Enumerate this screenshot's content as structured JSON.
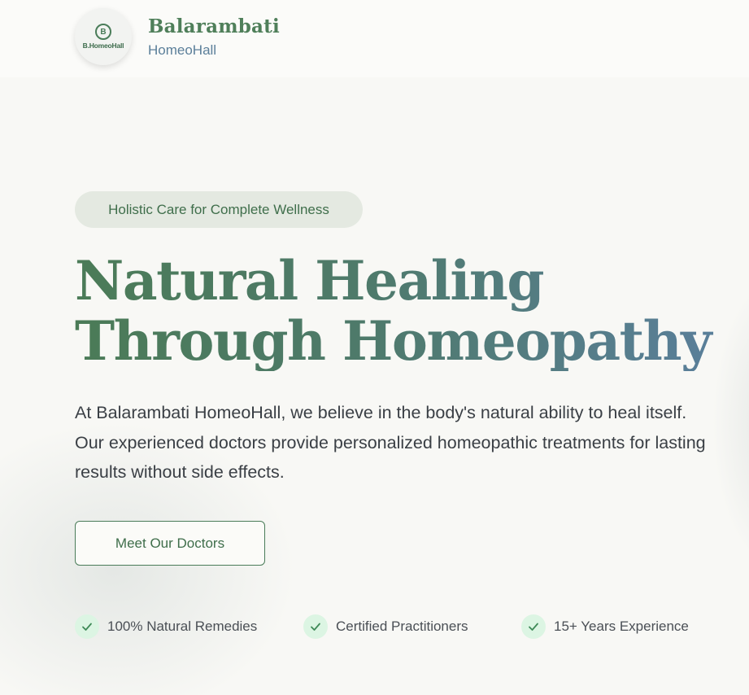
{
  "header": {
    "logo_mark": "B",
    "logo_text": "B.HomeoHall",
    "brand_name": "Balarambati",
    "brand_sub": "HomeoHall"
  },
  "hero": {
    "tagline": "Holistic Care for Complete Wellness",
    "headline_line1": "Natural Healing",
    "headline_line2": "Through Homeopathy",
    "description": "At Balarambati HomeoHall, we believe in the body's natural ability to heal itself. Our experienced doctors provide personalized homeopathic treatments for lasting results without side effects.",
    "cta_label": "Meet Our Doctors"
  },
  "features": [
    {
      "label": "100% Natural Remedies",
      "icon": "check-icon"
    },
    {
      "label": "Certified Practitioners",
      "icon": "check-icon"
    },
    {
      "label": "15+ Years Experience",
      "icon": "check-icon"
    }
  ],
  "colors": {
    "brand_green": "#4a7c59",
    "brand_blue": "#5b7f9a",
    "tagline_bg": "#e4e9e1",
    "check_bg": "#dcf5e3",
    "text_dark": "#3a3f45"
  }
}
